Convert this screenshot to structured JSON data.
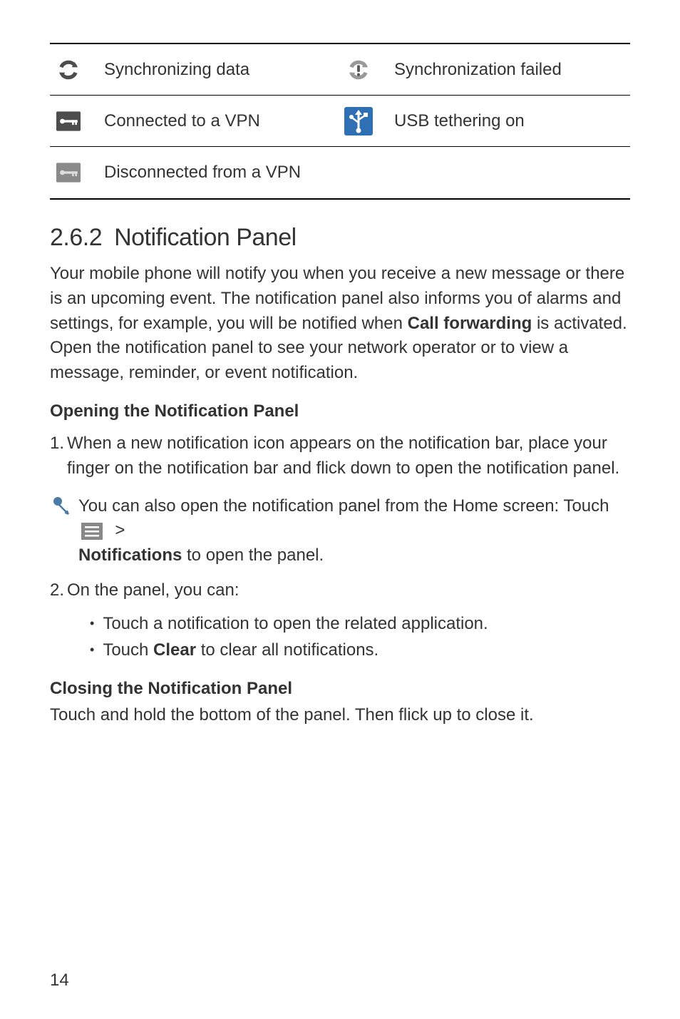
{
  "icons_table": {
    "rows": [
      {
        "left_label": "Synchronizing data",
        "right_label": "Synchronization failed"
      },
      {
        "left_label": "Connected to a VPN",
        "right_label": "USB tethering on"
      },
      {
        "left_label": "Disconnected from a VPN"
      }
    ]
  },
  "section": {
    "number": "2.6.2",
    "title": "Notification Panel",
    "paragraph_pre": "Your mobile phone will notify you when you receive a new message or there is an upcoming event. The notification panel also informs you of alarms and settings, for example, you will be notified when ",
    "paragraph_bold": "Call forwarding",
    "paragraph_post": " is activated. Open the notification panel to see your network operator or to view a message, reminder, or event notification."
  },
  "opening": {
    "heading": "Opening the Notification Panel",
    "step1_num": "1.",
    "step1": "When a new notification icon appears on the notification bar, place your finger on the notification bar and flick down to open the notification panel.",
    "tip_pre": "You can also open the notification panel from the Home screen: Touch ",
    "tip_gt": ">",
    "tip_bold": "Notifications",
    "tip_post": " to open the panel.",
    "step2_num": "2.",
    "step2": "On the panel, you can:",
    "bullet1": "Touch a notification to open the related application.",
    "bullet2_pre": "Touch ",
    "bullet2_bold": "Clear",
    "bullet2_post": " to clear all notifications."
  },
  "closing": {
    "heading": "Closing the Notification Panel",
    "text": "Touch and hold the bottom of the panel. Then flick up to close it."
  },
  "page_number": "14"
}
